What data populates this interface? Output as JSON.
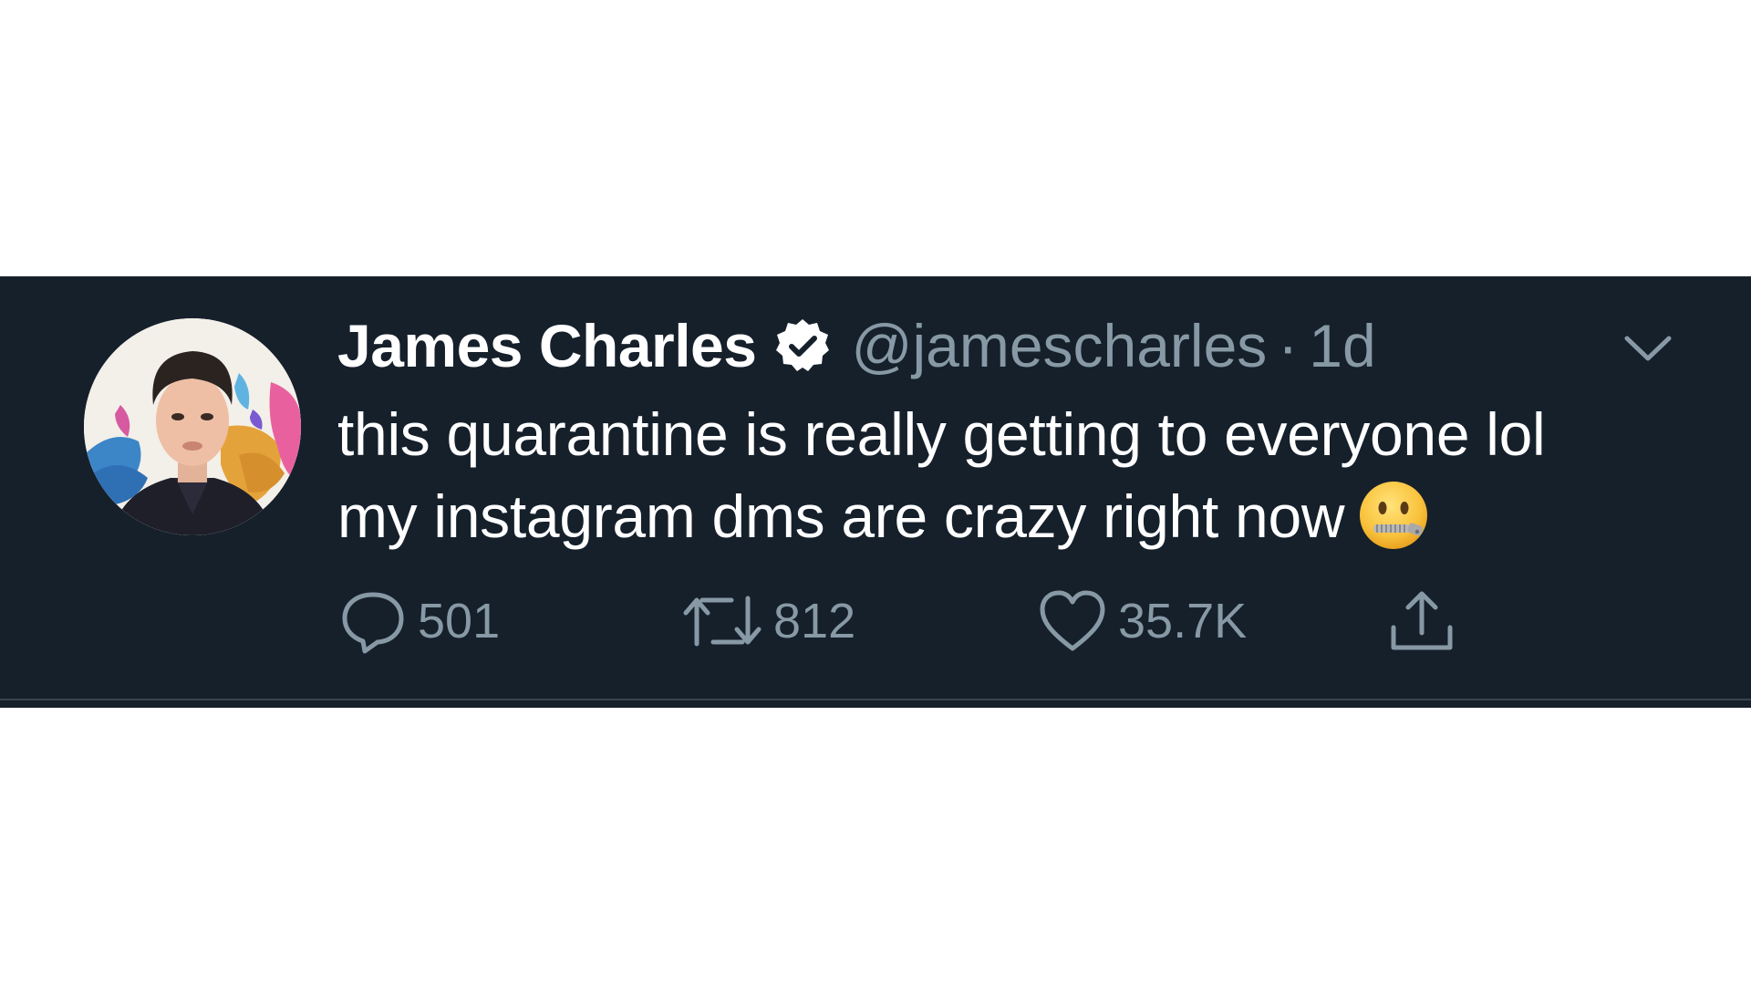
{
  "tweet": {
    "author": {
      "display_name": "James Charles",
      "handle": "@jamescharles",
      "verified": true
    },
    "separator": "·",
    "timestamp": "1d",
    "text_lines": [
      "this quarantine is really getting to everyone lol",
      "my instagram dms are crazy right now"
    ],
    "emoji": "zipper-mouth-face",
    "actions": {
      "reply_count": "501",
      "retweet_count": "812",
      "like_count": "35.7K"
    }
  },
  "theme": {
    "background": "#15202b",
    "secondary_text": "#8899a6",
    "divider": "#38444d"
  }
}
